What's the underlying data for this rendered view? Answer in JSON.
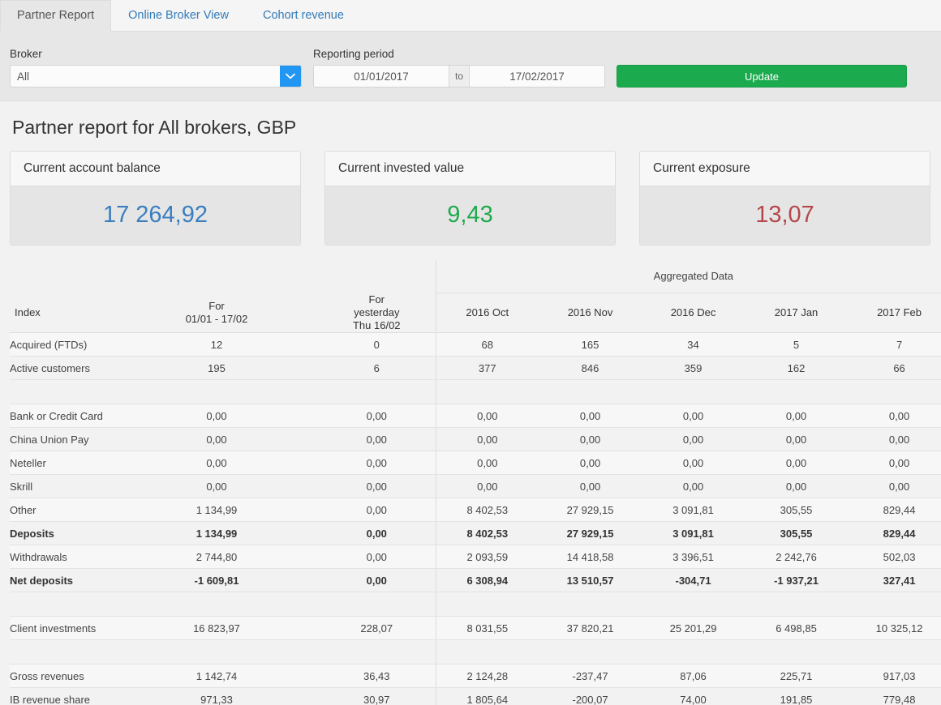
{
  "tabs": [
    {
      "label": "Partner Report",
      "active": true
    },
    {
      "label": "Online Broker View",
      "active": false
    },
    {
      "label": "Cohort revenue",
      "active": false
    }
  ],
  "filters": {
    "broker_label": "Broker",
    "broker_value": "All",
    "broker_placeholder": "All",
    "period_label": "Reporting period",
    "date_from": "01/01/2017",
    "date_to": "17/02/2017",
    "date_from_placeholder": "dd/mm/yyyy",
    "date_to_placeholder": "dd/mm/yyyy",
    "separator": "to",
    "update_label": "Update",
    "update_color": "#1bab4e",
    "dropdown_arrow_color": "#2196f3"
  },
  "page_title": "Partner report for All brokers, GBP",
  "cards": [
    {
      "title": "Current account balance",
      "value": "17 264,92",
      "color": "#3a7ebf"
    },
    {
      "title": "Current invested value",
      "value": "9,43",
      "color": "#1faa4b"
    },
    {
      "title": "Current exposure",
      "value": "13,07",
      "color": "#b5474a"
    }
  ],
  "table": {
    "group_header": "Aggregated Data",
    "columns": [
      {
        "key": "index",
        "label": "Index"
      },
      {
        "key": "period",
        "label": "For\n01/01 - 17/02"
      },
      {
        "key": "yesterday",
        "label": "For\nyesterday\nThu 16/02"
      },
      {
        "key": "oct2016",
        "label": "2016 Oct"
      },
      {
        "key": "nov2016",
        "label": "2016 Nov"
      },
      {
        "key": "dec2016",
        "label": "2016 Dec"
      },
      {
        "key": "jan2017",
        "label": "2017 Jan"
      },
      {
        "key": "feb2017",
        "label": "2017 Feb"
      }
    ],
    "column_labels": {
      "index": "Index",
      "period_line1": "For",
      "period_line2": "01/01 - 17/02",
      "yesterday_line1": "For",
      "yesterday_line2": "yesterday",
      "yesterday_line3": "Thu 16/02",
      "oct2016": "2016 Oct",
      "nov2016": "2016 Nov",
      "dec2016": "2016 Dec",
      "jan2017": "2017 Jan",
      "feb2017": "2017 Feb"
    },
    "rows": [
      {
        "type": "data",
        "bold": false,
        "label": "Acquired (FTDs)",
        "values": [
          "12",
          "0",
          "68",
          "165",
          "34",
          "5",
          "7"
        ]
      },
      {
        "type": "data",
        "bold": false,
        "label": "Active customers",
        "values": [
          "195",
          "6",
          "377",
          "846",
          "359",
          "162",
          "66"
        ]
      },
      {
        "type": "spacer",
        "bold": false,
        "label": "",
        "values": [
          "",
          "",
          "",
          "",
          "",
          "",
          ""
        ]
      },
      {
        "type": "data",
        "bold": false,
        "label": "Bank or Credit Card",
        "values": [
          "0,00",
          "0,00",
          "0,00",
          "0,00",
          "0,00",
          "0,00",
          "0,00"
        ]
      },
      {
        "type": "data",
        "bold": false,
        "label": "China Union Pay",
        "values": [
          "0,00",
          "0,00",
          "0,00",
          "0,00",
          "0,00",
          "0,00",
          "0,00"
        ]
      },
      {
        "type": "data",
        "bold": false,
        "label": "Neteller",
        "values": [
          "0,00",
          "0,00",
          "0,00",
          "0,00",
          "0,00",
          "0,00",
          "0,00"
        ]
      },
      {
        "type": "data",
        "bold": false,
        "label": "Skrill",
        "values": [
          "0,00",
          "0,00",
          "0,00",
          "0,00",
          "0,00",
          "0,00",
          "0,00"
        ]
      },
      {
        "type": "data",
        "bold": false,
        "label": "Other",
        "values": [
          "1 134,99",
          "0,00",
          "8 402,53",
          "27 929,15",
          "3 091,81",
          "305,55",
          "829,44"
        ]
      },
      {
        "type": "data",
        "bold": true,
        "label": "Deposits",
        "values": [
          "1 134,99",
          "0,00",
          "8 402,53",
          "27 929,15",
          "3 091,81",
          "305,55",
          "829,44"
        ]
      },
      {
        "type": "data",
        "bold": false,
        "label": "Withdrawals",
        "values": [
          "2 744,80",
          "0,00",
          "2 093,59",
          "14 418,58",
          "3 396,51",
          "2 242,76",
          "502,03"
        ]
      },
      {
        "type": "data",
        "bold": true,
        "label": "Net deposits",
        "values": [
          "-1 609,81",
          "0,00",
          "6 308,94",
          "13 510,57",
          "-304,71",
          "-1 937,21",
          "327,41"
        ]
      },
      {
        "type": "spacer",
        "bold": false,
        "label": "",
        "values": [
          "",
          "",
          "",
          "",
          "",
          "",
          ""
        ]
      },
      {
        "type": "data",
        "bold": false,
        "label": "Client investments",
        "values": [
          "16 823,97",
          "228,07",
          "8 031,55",
          "37 820,21",
          "25 201,29",
          "6 498,85",
          "10 325,12"
        ]
      },
      {
        "type": "spacer",
        "bold": false,
        "label": "",
        "values": [
          "",
          "",
          "",
          "",
          "",
          "",
          ""
        ]
      },
      {
        "type": "data",
        "bold": false,
        "label": "Gross revenues",
        "values": [
          "1 142,74",
          "36,43",
          "2 124,28",
          "-237,47",
          "87,06",
          "225,71",
          "917,03"
        ]
      },
      {
        "type": "data",
        "bold": false,
        "label": "IB revenue share",
        "values": [
          "971,33",
          "30,97",
          "1 805,64",
          "-200,07",
          "74,00",
          "191,85",
          "779,48"
        ]
      }
    ]
  }
}
